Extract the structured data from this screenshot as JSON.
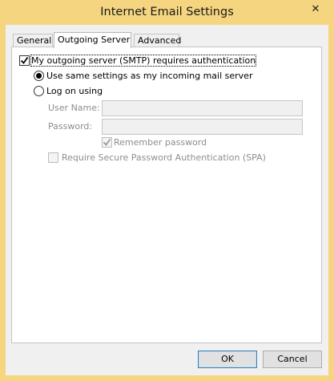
{
  "window": {
    "title": "Internet Email Settings",
    "close_glyph": "✕"
  },
  "tabs": [
    {
      "label": "General",
      "active": false
    },
    {
      "label": "Outgoing Server",
      "active": true
    },
    {
      "label": "Advanced",
      "active": false
    }
  ],
  "outgoing": {
    "requires_auth": {
      "label": "My outgoing server (SMTP) requires authentication",
      "checked": true
    },
    "use_same": {
      "label": "Use same settings as my incoming mail server",
      "selected": true
    },
    "log_on_using": {
      "label": "Log on using",
      "selected": false
    },
    "user_name": {
      "label": "User Name:",
      "value": ""
    },
    "password": {
      "label": "Password:",
      "value": ""
    },
    "remember_password": {
      "label": "Remember password",
      "checked": true,
      "enabled": false
    },
    "spa": {
      "label": "Require Secure Password Authentication (SPA)",
      "checked": false,
      "enabled": false
    }
  },
  "buttons": {
    "ok": "OK",
    "cancel": "Cancel"
  },
  "colors": {
    "frame": "#f5d580",
    "dialog": "#f0f0f0",
    "panel": "#ffffff",
    "disabled_text": "#8d8d8d"
  },
  "icons": [
    "close-icon",
    "checkmark-icon"
  ]
}
